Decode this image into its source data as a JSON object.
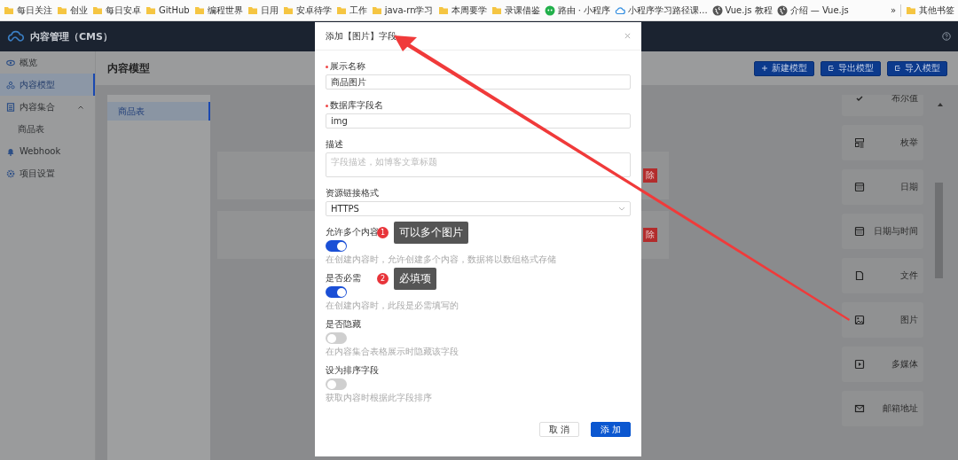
{
  "bookmarks": {
    "items": [
      {
        "label": "每日关注",
        "kind": "folder"
      },
      {
        "label": "创业",
        "kind": "folder"
      },
      {
        "label": "每日安卓",
        "kind": "folder"
      },
      {
        "label": "GitHub",
        "kind": "folder"
      },
      {
        "label": "编程世界",
        "kind": "folder"
      },
      {
        "label": "日用",
        "kind": "folder"
      },
      {
        "label": "安卓待学",
        "kind": "folder"
      },
      {
        "label": "工作",
        "kind": "folder"
      },
      {
        "label": "java-rn学习",
        "kind": "folder"
      },
      {
        "label": "本周要学",
        "kind": "folder"
      },
      {
        "label": "录课借鉴",
        "kind": "folder"
      },
      {
        "label": "路由 · 小程序",
        "kind": "chat"
      },
      {
        "label": "小程序学习路径课...",
        "kind": "cloud"
      },
      {
        "label": "Vue.js 教程",
        "kind": "globe"
      },
      {
        "label": "介绍 — Vue.js",
        "kind": "globe"
      }
    ],
    "overflow": "»",
    "other": {
      "label": "其他书签",
      "kind": "folder"
    }
  },
  "app": {
    "title": "内容管理（CMS）"
  },
  "sidebar": {
    "items": [
      {
        "label": "概览",
        "kind": "eye",
        "selected": false
      },
      {
        "label": "内容模型",
        "kind": "nodes",
        "selected": true
      },
      {
        "label": "内容集合",
        "kind": "doc",
        "selected": false,
        "expanded": true,
        "children": [
          {
            "label": "商品表",
            "selected": false
          }
        ]
      },
      {
        "label": "Webhook",
        "kind": "bell",
        "selected": false
      },
      {
        "label": "项目设置",
        "kind": "gear",
        "selected": false
      }
    ]
  },
  "page": {
    "title": "内容模型",
    "actions": [
      {
        "label": "新建模型",
        "kind": "plus"
      },
      {
        "label": "导出模型",
        "kind": "export"
      },
      {
        "label": "导入模型",
        "kind": "export"
      }
    ]
  },
  "models": [
    {
      "label": "商品表",
      "selected": true
    }
  ],
  "model_fields": [
    {
      "delete": "除"
    },
    {
      "delete": "除"
    }
  ],
  "field_types": [
    {
      "label": "布尔值",
      "kind": "check"
    },
    {
      "label": "枚举",
      "kind": "enum"
    },
    {
      "label": "日期",
      "kind": "calendar"
    },
    {
      "label": "日期与时间",
      "kind": "calendar"
    },
    {
      "label": "文件",
      "kind": "file"
    },
    {
      "label": "图片",
      "kind": "image"
    },
    {
      "label": "多媒体",
      "kind": "play"
    },
    {
      "label": "邮箱地址",
      "kind": "mail"
    }
  ],
  "dialog": {
    "title": "添加【图片】字段",
    "fields": [
      {
        "kind": "input",
        "label": "展示名称",
        "required": true,
        "value": "商品图片"
      },
      {
        "kind": "input",
        "label": "数据库字段名",
        "required": true,
        "value": "img"
      },
      {
        "kind": "textarea",
        "label": "描述",
        "required": false,
        "placeholder": "字段描述，如博客文章标题"
      },
      {
        "kind": "select",
        "label": "资源链接格式",
        "required": false,
        "value": "HTTPS"
      },
      {
        "kind": "switch",
        "label": "允许多个内容",
        "on": true,
        "hint": "在创建内容时，允许创建多个内容，数据将以数组格式存储",
        "callout": {
          "number": "1",
          "text": "可以多个图片"
        }
      },
      {
        "kind": "switch",
        "label": "是否必需",
        "on": true,
        "hint": "在创建内容时，此段是必需填写的",
        "callout": {
          "number": "2",
          "text": "必填项"
        }
      },
      {
        "kind": "switch",
        "label": "是否隐藏",
        "on": false,
        "hint": "在内容集合表格展示时隐藏该字段"
      },
      {
        "kind": "switch",
        "label": "设为排序字段",
        "on": false,
        "hint": "获取内容时根据此字段排序"
      }
    ],
    "cancel": "取 消",
    "confirm": "添 加"
  }
}
